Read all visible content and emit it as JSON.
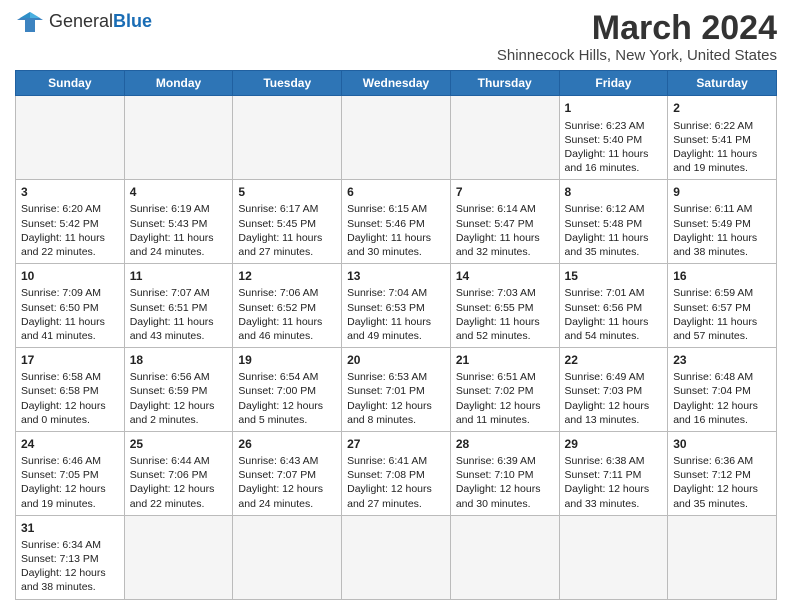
{
  "header": {
    "logo_general": "General",
    "logo_blue": "Blue",
    "month_title": "March 2024",
    "location": "Shinnecock Hills, New York, United States"
  },
  "weekdays": [
    "Sunday",
    "Monday",
    "Tuesday",
    "Wednesday",
    "Thursday",
    "Friday",
    "Saturday"
  ],
  "weeks": [
    [
      {
        "day": "",
        "info": ""
      },
      {
        "day": "",
        "info": ""
      },
      {
        "day": "",
        "info": ""
      },
      {
        "day": "",
        "info": ""
      },
      {
        "day": "",
        "info": ""
      },
      {
        "day": "1",
        "info": "Sunrise: 6:23 AM\nSunset: 5:40 PM\nDaylight: 11 hours and 16 minutes."
      },
      {
        "day": "2",
        "info": "Sunrise: 6:22 AM\nSunset: 5:41 PM\nDaylight: 11 hours and 19 minutes."
      }
    ],
    [
      {
        "day": "3",
        "info": "Sunrise: 6:20 AM\nSunset: 5:42 PM\nDaylight: 11 hours and 22 minutes."
      },
      {
        "day": "4",
        "info": "Sunrise: 6:19 AM\nSunset: 5:43 PM\nDaylight: 11 hours and 24 minutes."
      },
      {
        "day": "5",
        "info": "Sunrise: 6:17 AM\nSunset: 5:45 PM\nDaylight: 11 hours and 27 minutes."
      },
      {
        "day": "6",
        "info": "Sunrise: 6:15 AM\nSunset: 5:46 PM\nDaylight: 11 hours and 30 minutes."
      },
      {
        "day": "7",
        "info": "Sunrise: 6:14 AM\nSunset: 5:47 PM\nDaylight: 11 hours and 32 minutes."
      },
      {
        "day": "8",
        "info": "Sunrise: 6:12 AM\nSunset: 5:48 PM\nDaylight: 11 hours and 35 minutes."
      },
      {
        "day": "9",
        "info": "Sunrise: 6:11 AM\nSunset: 5:49 PM\nDaylight: 11 hours and 38 minutes."
      }
    ],
    [
      {
        "day": "10",
        "info": "Sunrise: 7:09 AM\nSunset: 6:50 PM\nDaylight: 11 hours and 41 minutes."
      },
      {
        "day": "11",
        "info": "Sunrise: 7:07 AM\nSunset: 6:51 PM\nDaylight: 11 hours and 43 minutes."
      },
      {
        "day": "12",
        "info": "Sunrise: 7:06 AM\nSunset: 6:52 PM\nDaylight: 11 hours and 46 minutes."
      },
      {
        "day": "13",
        "info": "Sunrise: 7:04 AM\nSunset: 6:53 PM\nDaylight: 11 hours and 49 minutes."
      },
      {
        "day": "14",
        "info": "Sunrise: 7:03 AM\nSunset: 6:55 PM\nDaylight: 11 hours and 52 minutes."
      },
      {
        "day": "15",
        "info": "Sunrise: 7:01 AM\nSunset: 6:56 PM\nDaylight: 11 hours and 54 minutes."
      },
      {
        "day": "16",
        "info": "Sunrise: 6:59 AM\nSunset: 6:57 PM\nDaylight: 11 hours and 57 minutes."
      }
    ],
    [
      {
        "day": "17",
        "info": "Sunrise: 6:58 AM\nSunset: 6:58 PM\nDaylight: 12 hours and 0 minutes."
      },
      {
        "day": "18",
        "info": "Sunrise: 6:56 AM\nSunset: 6:59 PM\nDaylight: 12 hours and 2 minutes."
      },
      {
        "day": "19",
        "info": "Sunrise: 6:54 AM\nSunset: 7:00 PM\nDaylight: 12 hours and 5 minutes."
      },
      {
        "day": "20",
        "info": "Sunrise: 6:53 AM\nSunset: 7:01 PM\nDaylight: 12 hours and 8 minutes."
      },
      {
        "day": "21",
        "info": "Sunrise: 6:51 AM\nSunset: 7:02 PM\nDaylight: 12 hours and 11 minutes."
      },
      {
        "day": "22",
        "info": "Sunrise: 6:49 AM\nSunset: 7:03 PM\nDaylight: 12 hours and 13 minutes."
      },
      {
        "day": "23",
        "info": "Sunrise: 6:48 AM\nSunset: 7:04 PM\nDaylight: 12 hours and 16 minutes."
      }
    ],
    [
      {
        "day": "24",
        "info": "Sunrise: 6:46 AM\nSunset: 7:05 PM\nDaylight: 12 hours and 19 minutes."
      },
      {
        "day": "25",
        "info": "Sunrise: 6:44 AM\nSunset: 7:06 PM\nDaylight: 12 hours and 22 minutes."
      },
      {
        "day": "26",
        "info": "Sunrise: 6:43 AM\nSunset: 7:07 PM\nDaylight: 12 hours and 24 minutes."
      },
      {
        "day": "27",
        "info": "Sunrise: 6:41 AM\nSunset: 7:08 PM\nDaylight: 12 hours and 27 minutes."
      },
      {
        "day": "28",
        "info": "Sunrise: 6:39 AM\nSunset: 7:10 PM\nDaylight: 12 hours and 30 minutes."
      },
      {
        "day": "29",
        "info": "Sunrise: 6:38 AM\nSunset: 7:11 PM\nDaylight: 12 hours and 33 minutes."
      },
      {
        "day": "30",
        "info": "Sunrise: 6:36 AM\nSunset: 7:12 PM\nDaylight: 12 hours and 35 minutes."
      }
    ],
    [
      {
        "day": "31",
        "info": "Sunrise: 6:34 AM\nSunset: 7:13 PM\nDaylight: 12 hours and 38 minutes."
      },
      {
        "day": "",
        "info": ""
      },
      {
        "day": "",
        "info": ""
      },
      {
        "day": "",
        "info": ""
      },
      {
        "day": "",
        "info": ""
      },
      {
        "day": "",
        "info": ""
      },
      {
        "day": "",
        "info": ""
      }
    ]
  ]
}
